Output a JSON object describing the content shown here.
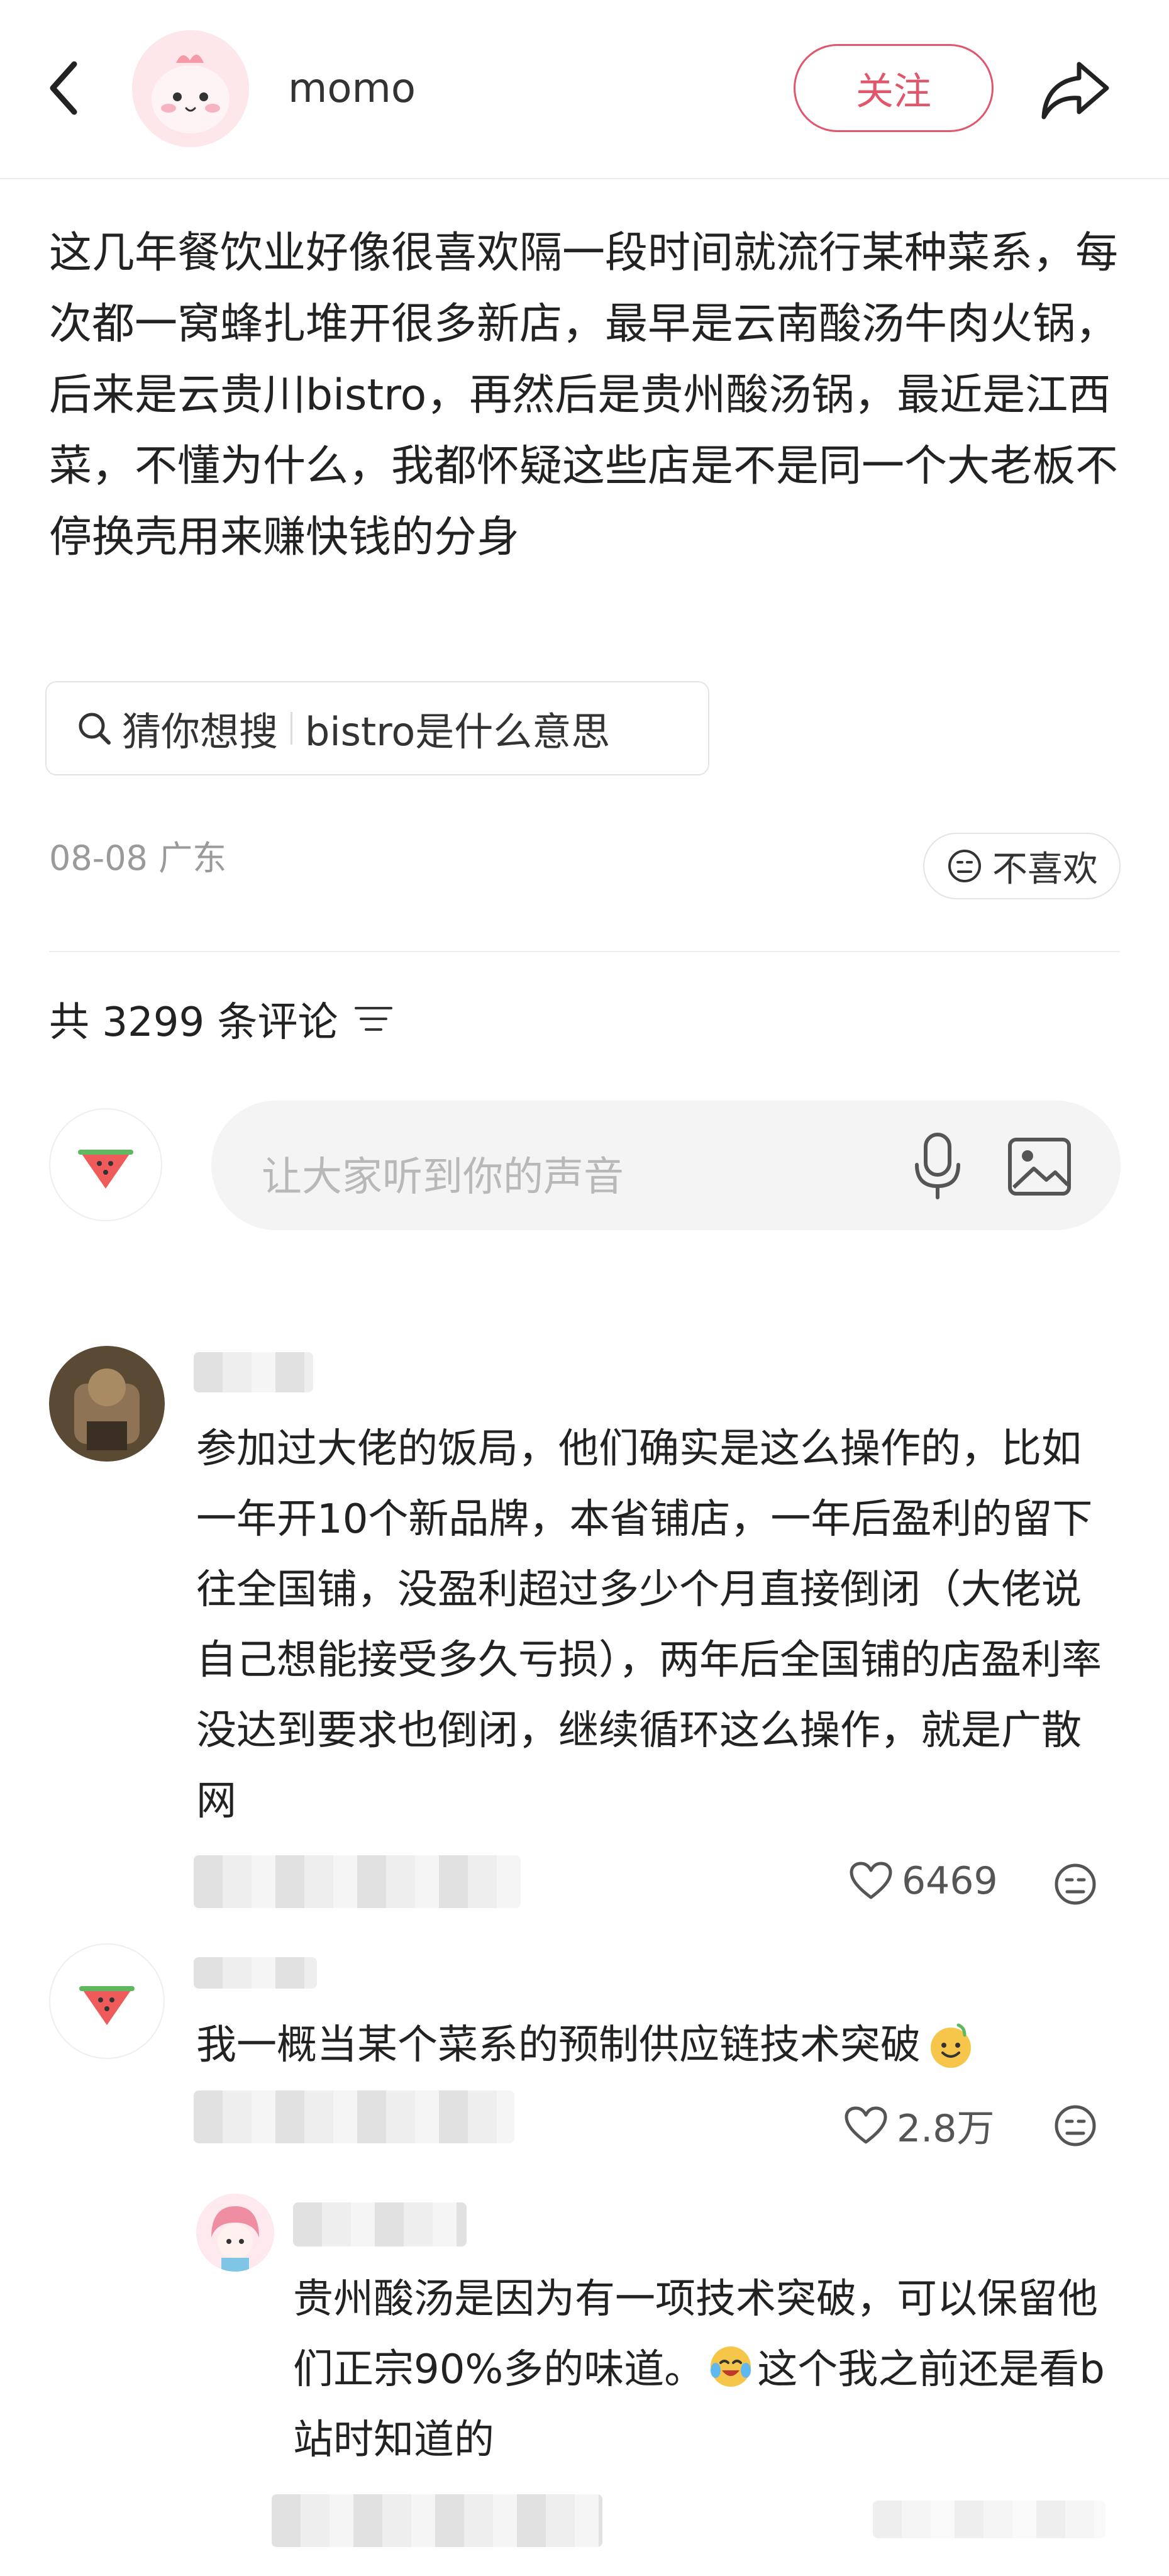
{
  "header": {
    "username": "momo",
    "follow_label": "关注"
  },
  "post": {
    "text": "这几年餐饮业好像很喜欢隔一段时间就流行某种菜系，每次都一窝蜂扎堆开很多新店，最早是云南酸汤牛肉火锅，后来是云贵川bistro，再然后是贵州酸汤锅，最近是江西菜，不懂为什么，我都怀疑这些店是不是同一个大老板不停换壳用来赚快钱的分身",
    "search_prefix": "猜你想搜",
    "search_query": "bistro是什么意思",
    "date_location": "08-08 广东",
    "dislike_label": "不喜欢"
  },
  "comments_section": {
    "count_label": "共 3299 条评论",
    "input_placeholder": "让大家听到你的声音"
  },
  "comments": [
    {
      "text": "参加过大佬的饭局，他们确实是这么操作的，比如一年开10个新品牌，本省铺店，一年后盈利的留下往全国铺，没盈利超过多少个月直接倒闭（大佬说自己想能接受多久亏损），两年后全国铺的店盈利率没达到要求也倒闭，继续循环这么操作，就是广散网",
      "likes": "6469"
    },
    {
      "text": "我一概当某个菜系的预制供应链技术突破",
      "likes": "2.8万"
    },
    {
      "text": "贵州酸汤是因为有一项技术突破，可以保留他们正宗90%多的味道。",
      "text_tail": "这个我之前还是看b站时知道的"
    }
  ],
  "icons": {
    "back": "chevron-left-icon",
    "share": "share-arrow-icon",
    "search": "search-icon",
    "dislike": "sad-face-icon",
    "sort": "sort-lines-icon",
    "mic": "mic-icon",
    "image": "image-icon",
    "like": "heart-icon"
  },
  "colors": {
    "accent": "#e0566a",
    "text": "#222222",
    "muted": "#9a9a9a",
    "input_bg": "#f4f4f4"
  }
}
